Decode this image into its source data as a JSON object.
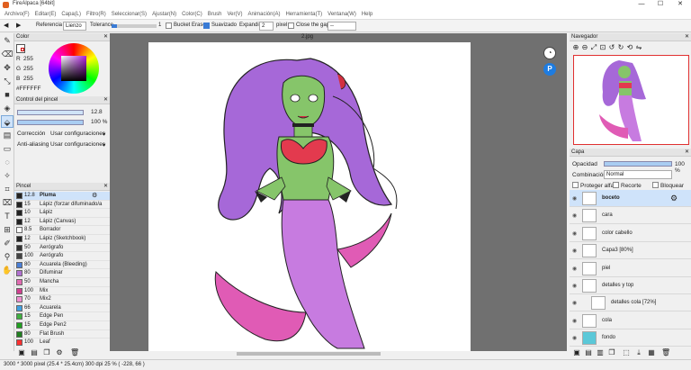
{
  "window": {
    "title": "FireAlpaca [64bit]",
    "min": "—",
    "max": "☐",
    "close": "✕"
  },
  "menu": [
    "Archivo(F)",
    "Editar(E)",
    "Capa(L)",
    "Filtro(R)",
    "Seleccionar(S)",
    "Ajustar(N)",
    "Color(C)",
    "Brush",
    "Ver(V)",
    "Animación(A)",
    "Herramienta(T)",
    "Ventana(W)",
    "Help"
  ],
  "toolbar": {
    "referencia_label": "Referencia",
    "referencia_value": "Lienzo",
    "tolerance_label": "Tolerance",
    "tolerance_value": "1",
    "bucket_erase": "Bucket Erase",
    "suavizado": "Suavizado",
    "expandir_label": "Expandir",
    "expandir_value": "2",
    "pixel": "pixel",
    "close_gap": "Close the gap",
    "gap_value": "--"
  },
  "color_panel": {
    "title": "Color",
    "r_label": "R",
    "r": "255",
    "g_label": "G",
    "g": "255",
    "b_label": "B",
    "b": "255",
    "hex": "#FFFFFF"
  },
  "brush_control": {
    "title": "Control del pincel",
    "size": "12.8",
    "opacity": "100 %",
    "correccion_label": "Corrección",
    "correccion_value": "Usar configuraciones",
    "antialias_label": "Anti-aliasing",
    "antialias_value": "Usar configuraciones"
  },
  "brush_panel": {
    "title": "Pincel",
    "items": [
      {
        "size": "12.8",
        "name": "Pluma",
        "color": "#222222"
      },
      {
        "size": "15",
        "name": "Lápiz (forzar difuminado/a",
        "color": "#222222"
      },
      {
        "size": "10",
        "name": "Lápiz",
        "color": "#222222"
      },
      {
        "size": "12",
        "name": "Lápiz (Canvas)",
        "color": "#222222"
      },
      {
        "size": "8.5",
        "name": "Borrador",
        "color": "#ffffff"
      },
      {
        "size": "12",
        "name": "Lápiz (Sketchbook)",
        "color": "#222222"
      },
      {
        "size": "50",
        "name": "Aerógrafo",
        "color": "#333333"
      },
      {
        "size": "100",
        "name": "Aerógrafo",
        "color": "#444444"
      },
      {
        "size": "80",
        "name": "Acuarela (Bleeding)",
        "color": "#4a7fd6"
      },
      {
        "size": "80",
        "name": "Difuminar",
        "color": "#b070d0"
      },
      {
        "size": "50",
        "name": "Mancha",
        "color": "#e06bb0"
      },
      {
        "size": "100",
        "name": "Mix",
        "color": "#d04090"
      },
      {
        "size": "70",
        "name": "Mix2",
        "color": "#f08fd0"
      },
      {
        "size": "66",
        "name": "Acuarela",
        "color": "#3fa0e0"
      },
      {
        "size": "15",
        "name": "Edge Pen",
        "color": "#40b040"
      },
      {
        "size": "15",
        "name": "Edge Pen2",
        "color": "#20a020"
      },
      {
        "size": "80",
        "name": "Flat Brush",
        "color": "#208020"
      },
      {
        "size": "100",
        "name": "Leaf",
        "color": "#ff3030"
      }
    ]
  },
  "document": {
    "tab": "2.jpg"
  },
  "navigator": {
    "title": "Navegador"
  },
  "layers": {
    "title": "Capa",
    "opacity_label": "Opacidad",
    "opacity_value": "100 %",
    "blend_label": "Combinación",
    "blend_value": "Normal",
    "protect": "Proteger alfa",
    "clip": "Recorte",
    "lock": "Bloquear",
    "items": [
      {
        "name": "boceto",
        "selected": true
      },
      {
        "name": "cara"
      },
      {
        "name": "color cabello"
      },
      {
        "name": "Capa3 [80%]"
      },
      {
        "name": "piel"
      },
      {
        "name": "detalles y top"
      },
      {
        "name": "detalles cola [72%]"
      },
      {
        "name": "cola"
      },
      {
        "name": "fondo"
      }
    ]
  },
  "status": "3000 * 3000 pixel  (25.4 * 25.4cm)  300 dpi  25 %  ( -228, 66 )"
}
